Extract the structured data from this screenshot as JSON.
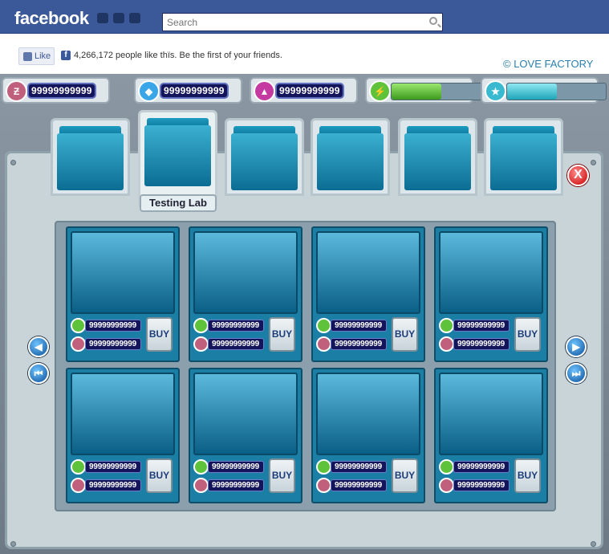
{
  "facebook": {
    "logo": "facebook",
    "search_placeholder": "Search",
    "like_label": "Like",
    "like_count_text": "4,266,172 people like thїs. Be the first of your friends."
  },
  "game": {
    "copyright": "© LOVE FACTORY",
    "resources": [
      {
        "icon": "money-icon",
        "value": "99999999999",
        "color": "#c0607c"
      },
      {
        "icon": "crystal-icon",
        "value": "99999999999",
        "color": "#3aa6e8"
      },
      {
        "icon": "upgrade-icon",
        "value": "99999999999",
        "color": "#c43aa0"
      },
      {
        "icon": "energy-icon",
        "progress": 0.5,
        "color": "#5ec23a"
      },
      {
        "icon": "star-icon",
        "progress": 0.5,
        "color": "#3abad0"
      }
    ],
    "tabs": [
      {
        "name": "tab-machine",
        "icon": "machine-icon"
      },
      {
        "name": "tab-testing-lab",
        "icon": "testing-lab-icon",
        "active": true
      },
      {
        "name": "tab-tanker-truck",
        "icon": "truck-icon"
      },
      {
        "name": "tab-platform",
        "icon": "platform-icon"
      },
      {
        "name": "tab-silo",
        "icon": "silo-icon"
      },
      {
        "name": "tab-palm-tree",
        "icon": "palm-tree-icon"
      }
    ],
    "active_tab_label": "Testing Lab",
    "close_label": "X",
    "items": [
      {
        "energy": "99999999999",
        "money": "99999999999",
        "buy": "BUY"
      },
      {
        "energy": "99999999999",
        "money": "99999999999",
        "buy": "BUY"
      },
      {
        "energy": "99999999999",
        "money": "99999999999",
        "buy": "BUY"
      },
      {
        "energy": "99999999999",
        "money": "99999999999",
        "buy": "BUY"
      },
      {
        "energy": "99999999999",
        "money": "99999999999",
        "buy": "BUY"
      },
      {
        "energy": "99999999999",
        "money": "99999999999",
        "buy": "BUY"
      },
      {
        "energy": "99999999999",
        "money": "99999999999",
        "buy": "BUY"
      },
      {
        "energy": "99999999999",
        "money": "99999999999",
        "buy": "BUY"
      }
    ]
  }
}
